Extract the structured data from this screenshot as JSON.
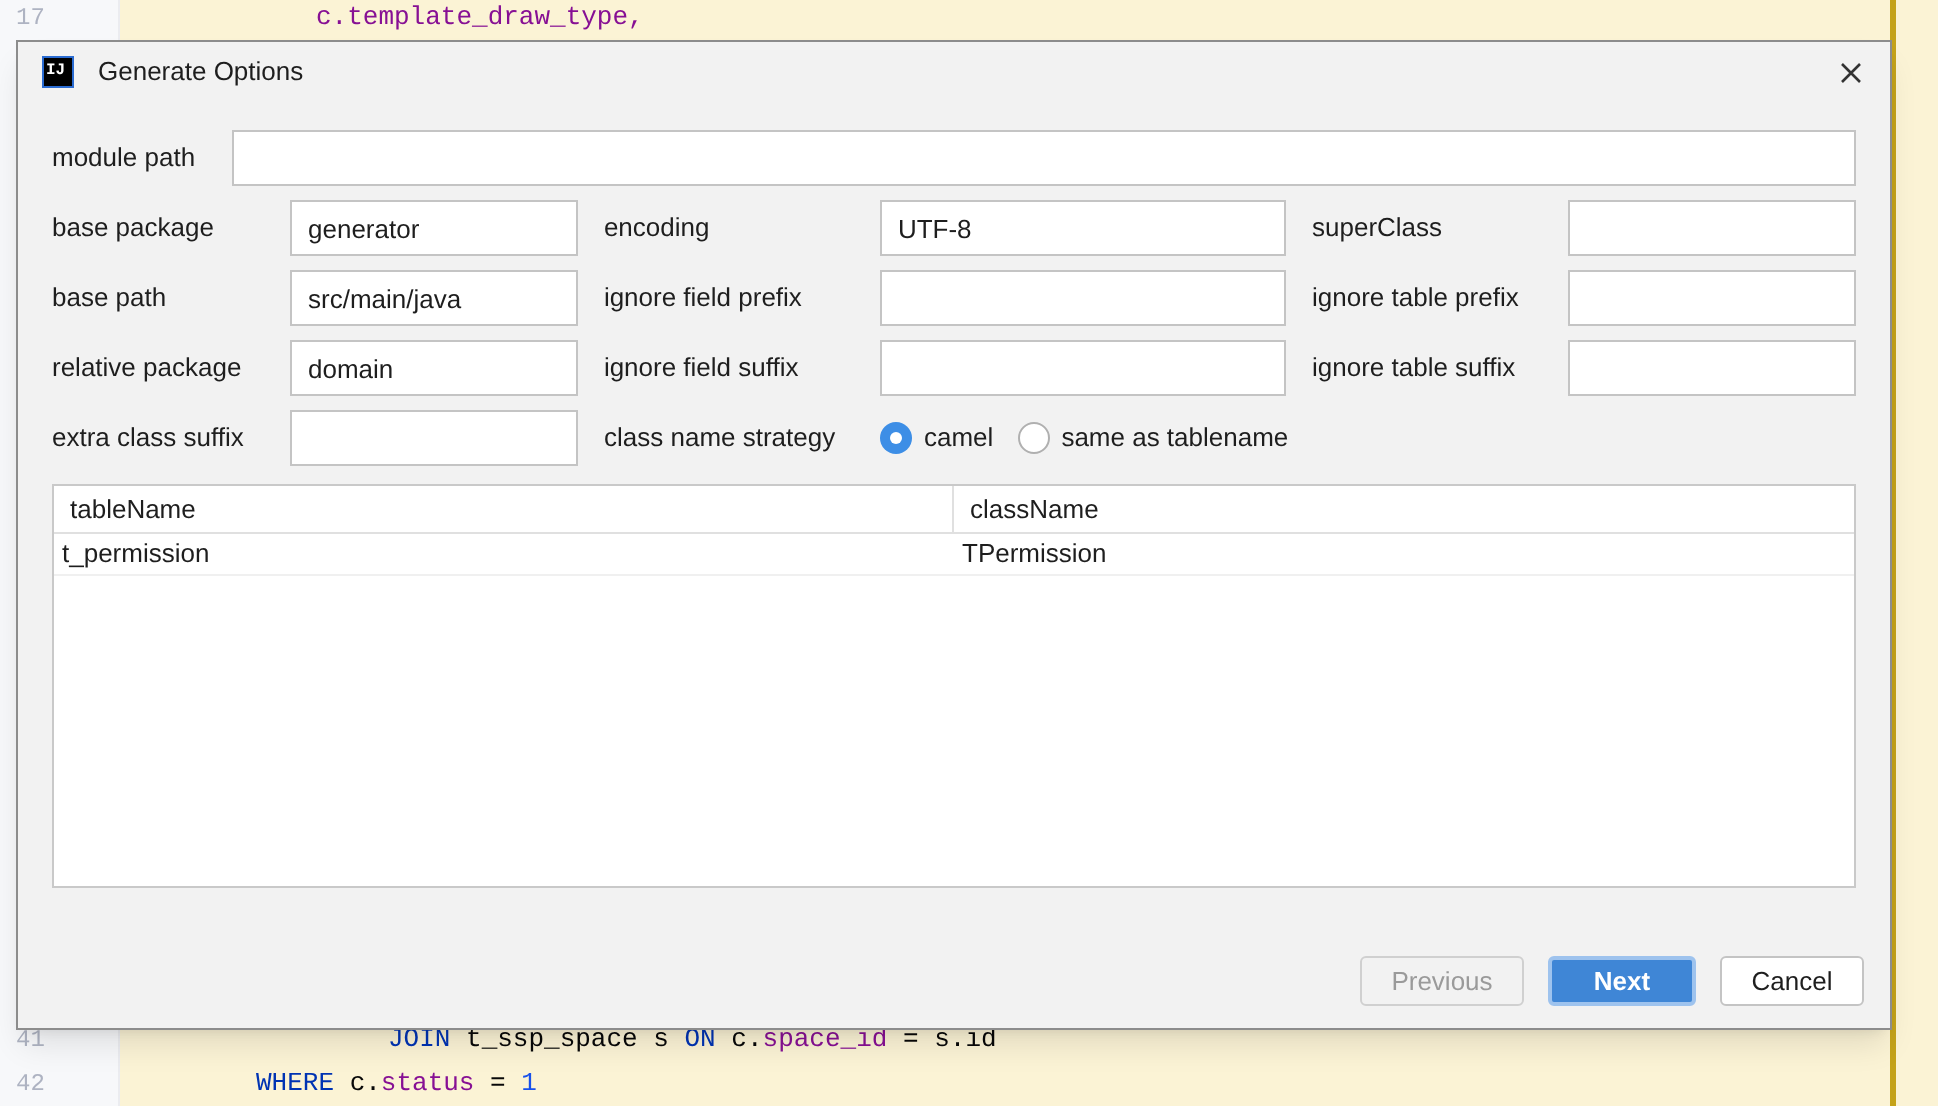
{
  "editor": {
    "top_lines": [
      {
        "number": "17",
        "code": "c.template_draw_type,"
      }
    ],
    "bottom_lines": [
      {
        "number": "41",
        "kind": "join",
        "tokens": [
          {
            "kind": "keyword",
            "text": "JOIN"
          },
          {
            "kind": "plain",
            "text": " t_ssp_space s "
          },
          {
            "kind": "keyword",
            "text": "ON"
          },
          {
            "kind": "plain",
            "text": " c."
          },
          {
            "kind": "field",
            "text": "space_id"
          },
          {
            "kind": "plain",
            "text": " = s.id"
          }
        ]
      },
      {
        "number": "42",
        "kind": "clause",
        "tokens": [
          {
            "kind": "keyword",
            "text": "WHERE"
          },
          {
            "kind": "plain",
            "text": " c."
          },
          {
            "kind": "field",
            "text": "status"
          },
          {
            "kind": "plain",
            "text": " = "
          },
          {
            "kind": "number",
            "text": "1"
          }
        ]
      }
    ]
  },
  "dialog": {
    "title": "Generate Options",
    "app_icon": "IJ",
    "module_path": {
      "label": "module path"
    },
    "rows": [
      [
        {
          "label": "base package",
          "value": "generator"
        },
        {
          "label": "encoding",
          "value": "UTF-8"
        },
        {
          "label": "superClass"
        }
      ],
      [
        {
          "label": "base path",
          "value": "src/main/java"
        },
        {
          "label": "ignore field prefix"
        },
        {
          "label": "ignore table prefix"
        }
      ],
      [
        {
          "label": "relative package",
          "value": "domain"
        },
        {
          "label": "ignore field suffix"
        },
        {
          "label": "ignore table suffix"
        }
      ]
    ],
    "extra_class_suffix": {
      "label": "extra class suffix"
    },
    "strategy": {
      "label": "class name strategy",
      "options": [
        {
          "label": "camel",
          "selected": true
        },
        {
          "label": "same as tablename",
          "selected": false
        }
      ]
    },
    "table": {
      "columns": [
        "tableName",
        "className"
      ],
      "rows": [
        [
          "t_permission",
          "TPermission"
        ]
      ]
    },
    "buttons": [
      {
        "label": "Previous",
        "disabled": true,
        "primary": false
      },
      {
        "label": "Next",
        "disabled": false,
        "primary": true
      },
      {
        "label": "Cancel",
        "disabled": false,
        "primary": false
      }
    ]
  }
}
